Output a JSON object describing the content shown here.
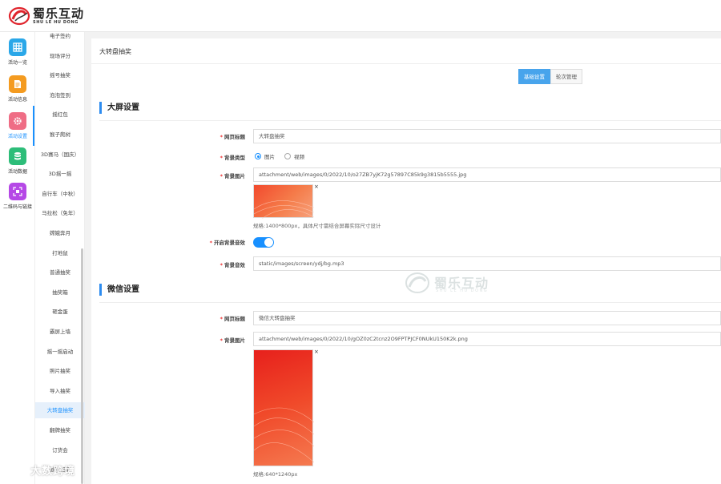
{
  "header": {
    "logo_cn": "蜀乐互动",
    "logo_en": "SHU LE HU DONG"
  },
  "rail": {
    "items": [
      {
        "label": "活动一览",
        "color": "#2aa7e8",
        "icon": "grid-icon"
      },
      {
        "label": "活动信息",
        "color": "#f49b20",
        "icon": "document-icon"
      },
      {
        "label": "活动设置",
        "color": "#ef6d85",
        "icon": "gear-icon"
      },
      {
        "label": "活动数据",
        "color": "#2dbd79",
        "icon": "database-icon"
      },
      {
        "label": "二维码与链接",
        "color": "#b548e6",
        "icon": "qrcode-icon"
      }
    ]
  },
  "submenu": {
    "items": [
      "电子签约",
      "现场评分",
      "摇号抽奖",
      "泡泡签到",
      "摇红包",
      "猴子爬树",
      "3D赛马（国庆）",
      "3D摇一摇",
      "自行车（中秋）",
      "马拉松（免年）",
      "嫦娥奔月",
      "打地鼠",
      "普通抽奖",
      "抽奖箱",
      "砸金蛋",
      "霸屏上墙",
      "摇一摇启动",
      "照片抽奖",
      "导入抽奖",
      "大转盘抽奖",
      "翻牌抽奖",
      "订货会",
      "抽奖记录"
    ],
    "active_index": 19
  },
  "page": {
    "title": "大转盘抽奖",
    "tabs": [
      "基础设置",
      "轮次管理"
    ]
  },
  "big_screen": {
    "section_title": "大屏设置",
    "page_title_label": "网页标题",
    "page_title_value": "大转盘抽奖",
    "bg_type_label": "背景类型",
    "bg_type_options": [
      "图片",
      "视频"
    ],
    "bg_image_label": "背景图片",
    "bg_image_value": "attachment/web/images/0/2022/10/o27ZB7yjK72g57897C85k9g3815b5555.jpg",
    "bg_image_hint": "规格:1400*800px，具体尺寸需结合屏幕实际尺寸设计",
    "bg_sound_toggle_label": "开启背景音效",
    "bg_sound_label": "背景音效",
    "bg_sound_value": "static/images/screen/ydj/bg.mp3"
  },
  "wechat": {
    "section_title": "微信设置",
    "page_title_label": "网页标题",
    "page_title_value": "微信大转盘抽奖",
    "bg_image_label": "背景图片",
    "bg_image_value": "attachment/web/images/0/2022/10/gOZ0zC2tcnz2O9FPTPJCF0NUkU150K2k.png",
    "bg_image_hint": "规格:640*1240px"
  },
  "watermark": {
    "text_cn": "蜀乐互动",
    "text_en": "SHU LE HU DONG"
  },
  "corner_watermark": "大数跨境",
  "close_glyph": "×",
  "required_mark": "*",
  "colors": {
    "accent": "#1890ff",
    "tab_active": "#48a4ec"
  }
}
